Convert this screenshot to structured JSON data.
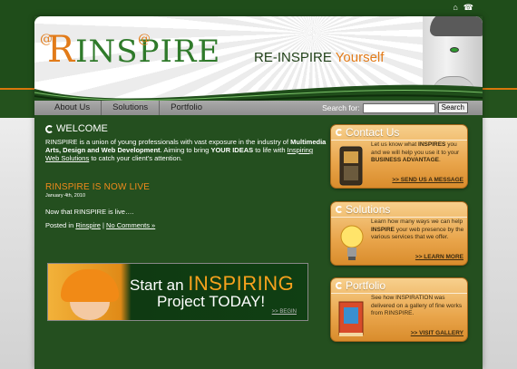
{
  "top_icons": {
    "home": "home-icon",
    "contact": "phone-icon"
  },
  "header": {
    "logo_initial": "R",
    "logo_rest": "INSPIRE",
    "tagline_main": "RE-INSPIRE",
    "tagline_accent": "Yourself"
  },
  "nav": {
    "items": [
      "About Us",
      "Solutions",
      "Portfolio"
    ],
    "search_label": "Search for:",
    "search_value": "",
    "search_button": "Search"
  },
  "welcome": {
    "heading": "WELCOME",
    "text_1": "RINSPIRE is a union of young professionals with vast exposure in the industry of",
    "text_bold_1": "Multimedia Arts, Design and Web Development",
    "text_2": ". Aiming to bring",
    "text_bold_2": "YOUR IDEAS",
    "text_3": "to life with",
    "text_link": "Inspiring Web Solutions",
    "text_4": "to catch your client's attention."
  },
  "post": {
    "title": "RINSPIRE IS NOW LIVE",
    "date": "January 4th, 2010",
    "body": "Now that RINSPIRE is live….",
    "posted_in": "Posted in",
    "category": "Rinspire",
    "separator": "|",
    "comments": "No Comments »"
  },
  "banner": {
    "start": "Start an",
    "inspiring": "INSPIRING",
    "project": "Project TODAY!",
    "begin": ">> BEGIN"
  },
  "boxes": [
    {
      "title": "Contact Us",
      "t1": "Let us know what",
      "b1": "INSPIRES",
      "t2": "you and we will help you use it to your",
      "b2": "BUSINESS ADVANTAGE",
      "t3": ".",
      "link": ">> SEND US A MESSAGE"
    },
    {
      "title": "Solutions",
      "t1": "Learn how many ways we can help",
      "b1": "INSPIRE",
      "t2": "your web presence by the various services that we offer.",
      "link": ">> LEARN MORE"
    },
    {
      "title": "Portfolio",
      "t1": "See how INSPIRATION was delivered on a gallery of fine works from RINSPIRE.",
      "link": ">> VISIT GALLERY"
    }
  ],
  "colors": {
    "green": "#244f1f",
    "orange": "#e27b19",
    "box": "#e9a54b"
  }
}
